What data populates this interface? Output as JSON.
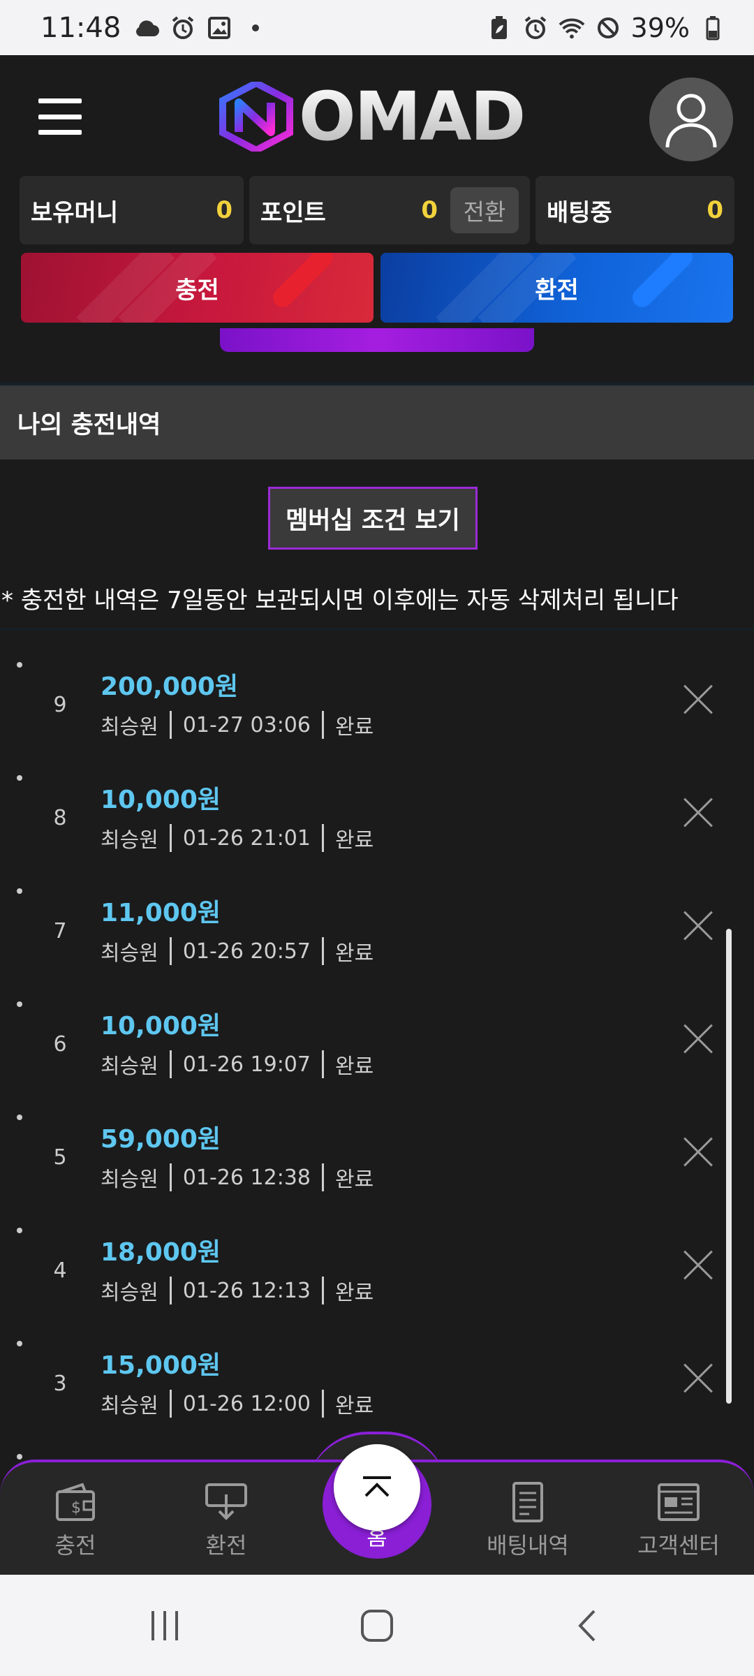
{
  "status_bar": {
    "time": "11:48",
    "battery": "39%",
    "left_icons": [
      "cloud-icon",
      "alarm-icon",
      "gallery-icon",
      "dot-icon"
    ],
    "right_icons": [
      "battery-saver-icon",
      "alarm-icon",
      "wifi-icon",
      "dnd-icon"
    ]
  },
  "header": {
    "logo_text": "OMAD",
    "menu_icon": "hamburger-menu-icon",
    "profile_icon": "user-avatar-icon"
  },
  "balances": {
    "money_label": "보유머니",
    "money_value": "0",
    "points_label": "포인트",
    "points_value": "0",
    "convert_label": "전환",
    "betting_label": "배팅중",
    "betting_value": "0"
  },
  "actions": {
    "deposit": "충전",
    "withdraw": "환전"
  },
  "section": {
    "title": "나의 충전내역",
    "membership_button": "멤버십 조건 보기",
    "notice": "* 충전한 내역은 7일동안 보관되시면 이후에는 자동 삭제처리 됩니다"
  },
  "history": [
    {
      "num": "9",
      "amount": "200,000원",
      "name": "최승원",
      "datetime": "01-27 03:06",
      "status": "완료"
    },
    {
      "num": "8",
      "amount": "10,000원",
      "name": "최승원",
      "datetime": "01-26 21:01",
      "status": "완료"
    },
    {
      "num": "7",
      "amount": "11,000원",
      "name": "최승원",
      "datetime": "01-26 20:57",
      "status": "완료"
    },
    {
      "num": "6",
      "amount": "10,000원",
      "name": "최승원",
      "datetime": "01-26 19:07",
      "status": "완료"
    },
    {
      "num": "5",
      "amount": "59,000원",
      "name": "최승원",
      "datetime": "01-26 12:38",
      "status": "완료"
    },
    {
      "num": "4",
      "amount": "18,000원",
      "name": "최승원",
      "datetime": "01-26 12:13",
      "status": "완료"
    },
    {
      "num": "3",
      "amount": "15,000원",
      "name": "최승원",
      "datetime": "01-26 12:00",
      "status": "완료"
    }
  ],
  "bottom_nav": {
    "deposit": "충전",
    "withdraw": "환전",
    "home": "홈",
    "betting_history": "배팅내역",
    "support": "고객센터"
  },
  "colors": {
    "accent_purple": "#8a1fd6",
    "amount_blue": "#5ec7f0",
    "balance_yellow": "#f2d23c"
  }
}
